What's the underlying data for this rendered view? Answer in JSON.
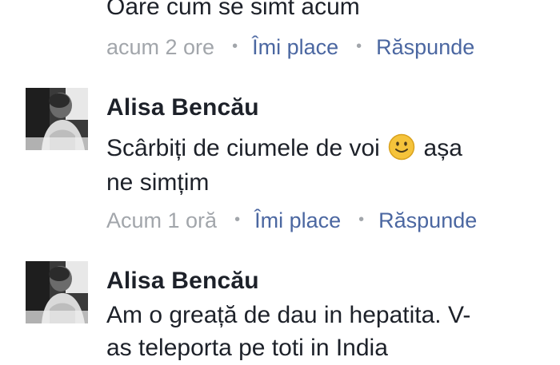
{
  "comments": [
    {
      "body_lines": [
        "Oare cum se simt acum"
      ],
      "time": "acum 2 ore",
      "like_label": "Îmi place",
      "reply_label": "Răspunde",
      "separator": "•"
    },
    {
      "author": "Alisa Bencău",
      "avatar_icon": "user-avatar-photo",
      "body_part1": "Scârbiți de ciumele de voi",
      "body_emoji": "slightly-smiling-face-icon",
      "body_part2": "așa",
      "body_line2": "ne simțim",
      "time": "Acum 1 oră",
      "like_label": "Îmi place",
      "reply_label": "Răspunde",
      "separator": "•"
    },
    {
      "author": "Alisa Bencău",
      "avatar_icon": "user-avatar-photo",
      "body_lines": [
        "Am o greață de dau in hepatita. V-",
        "as teleporta pe toti in India"
      ]
    }
  ],
  "colors": {
    "text": "#1d2129",
    "meta": "#a2a6ab",
    "action": "#4b67a1",
    "emoji": "#f5c33b"
  }
}
